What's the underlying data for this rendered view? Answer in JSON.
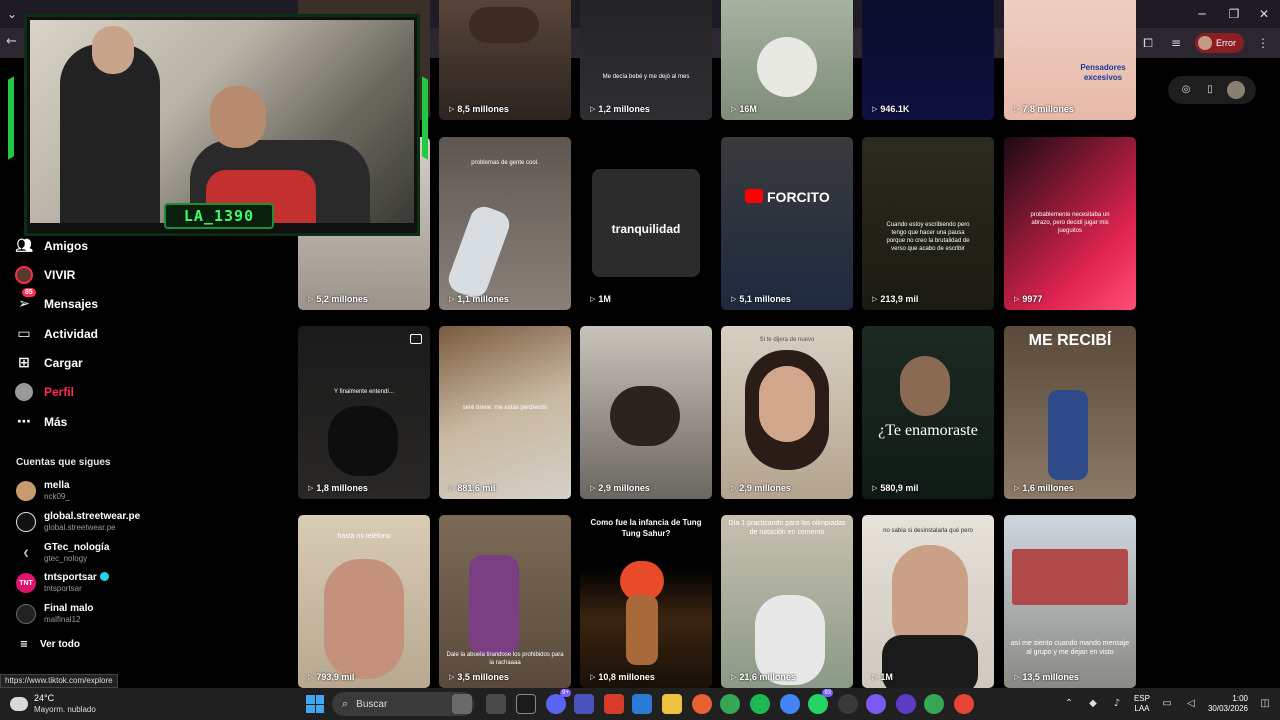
{
  "browser": {
    "error_label": "Error"
  },
  "stream_overlay": {
    "streamer_name": "LA_1390"
  },
  "sidebar": {
    "nav": [
      {
        "label": "Amigos",
        "icon": "friends-icon"
      },
      {
        "label": "VIVIR",
        "icon": "live-avatar-icon"
      },
      {
        "label": "Mensajes",
        "icon": "messages-icon",
        "badge": "85"
      },
      {
        "label": "Actividad",
        "icon": "activity-icon"
      },
      {
        "label": "Cargar",
        "icon": "upload-icon"
      },
      {
        "label": "Perfil",
        "icon": "profile-avatar-icon",
        "accent": "#ff2c55"
      },
      {
        "label": "Más",
        "icon": "more-icon"
      }
    ],
    "following_title": "Cuentas que sigues",
    "following": [
      {
        "name": "mella",
        "handle": "nck09_",
        "verified": false
      },
      {
        "name": "global.streetwear.pe",
        "handle": "global.streetwear.pe",
        "verified": false
      },
      {
        "name": "GTec_nología",
        "handle": "gtec_nology",
        "verified": false
      },
      {
        "name": "tntsportsar",
        "handle": "tntsportsar",
        "verified": true,
        "avatar_text": "TNT"
      },
      {
        "name": "Final malo",
        "handle": "malfinal12",
        "verified": false
      }
    ],
    "see_all": "Ver todo"
  },
  "status_url": "https://www.tiktok.com/explore",
  "grid": {
    "rows": [
      [
        {
          "views": "",
          "caption": ""
        },
        {
          "views": "8,5 millones",
          "caption": ""
        },
        {
          "views": "1,2 millones",
          "caption": "Me decía bebé y me dejó al mes"
        },
        {
          "views": "16M",
          "caption": ""
        },
        {
          "views": "946.1K",
          "caption": ""
        },
        {
          "views": "7,8 millones",
          "caption": "Pensadores excesivos"
        }
      ],
      [
        {
          "views": "5,2 millones",
          "caption": ""
        },
        {
          "views": "1,1 millones",
          "caption": "problemas de gente cool."
        },
        {
          "views": "1M",
          "caption": "tranquilidad"
        },
        {
          "views": "5,1 millones",
          "caption": "FORCITO"
        },
        {
          "views": "213,9 mil",
          "caption": "Cuando estoy escribiendo pero tengo que hacer una pausa porque no creo la brutalidad de verso que acabo de escribir"
        },
        {
          "views": "9977",
          "caption": "probablemente necesitaba un abrazo, pero decidí jugar mis jueguitos"
        }
      ],
      [
        {
          "views": "1,8 millones",
          "caption": "Y finalmente entendí..."
        },
        {
          "views": "881,6 mil",
          "caption": "seré breve: me estás perdiendo"
        },
        {
          "views": "2,9 millones",
          "caption": ""
        },
        {
          "views": "2,9 millones",
          "caption": "Si te dijera de nuevo"
        },
        {
          "views": "580,9 mil",
          "caption": "¿Te enamoraste"
        },
        {
          "views": "1,6 millones",
          "caption": "ME RECIBÍ"
        }
      ],
      [
        {
          "views": "793,9 mil",
          "caption": "hasta mi teléfono"
        },
        {
          "views": "3,5 millones",
          "caption": "Dale la abuela tirandose los prohibidos para la rachaaaa"
        },
        {
          "views": "10,8 millones",
          "caption": "Como fue la infancia de Tung Tung Sahur?"
        },
        {
          "views": "21,6 millones",
          "caption": "Día 1 practicando para las olimpiadas de natación en cemento"
        },
        {
          "views": "1M",
          "caption": "no sabía si desinstalarla qué pero"
        },
        {
          "views": "13,5 millones",
          "caption": "así me siento cuando mando mensaje al grupo y me dejan en visto"
        }
      ]
    ]
  },
  "taskbar": {
    "temperature": "24°C",
    "weather": "Mayorm. nublado",
    "search_placeholder": "Buscar",
    "lang_top": "ESP",
    "lang_bottom": "LAA",
    "time": "1:00",
    "date": "30/03/2026",
    "badges": {
      "discord": "9+",
      "messenger": "93"
    }
  }
}
